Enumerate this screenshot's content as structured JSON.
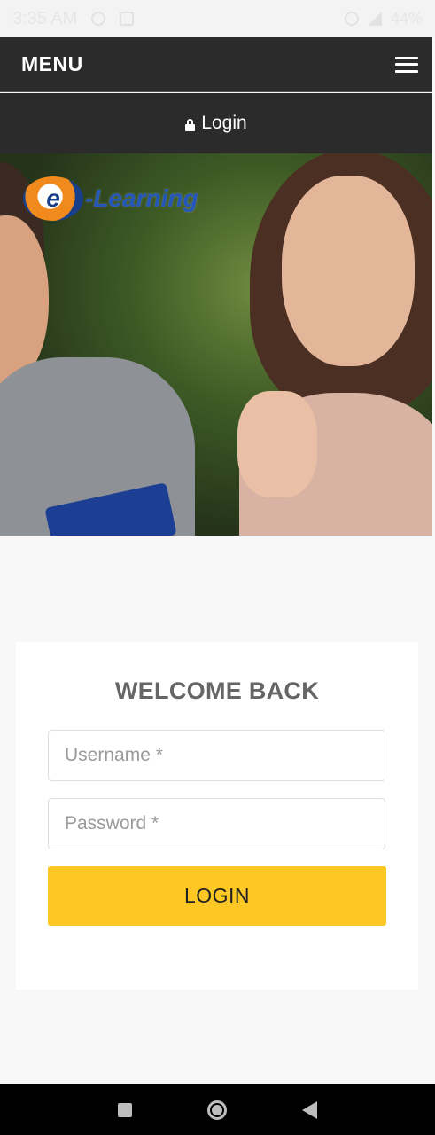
{
  "status_bar": {
    "time": "3:35 AM",
    "battery": "44%"
  },
  "menu": {
    "title": "MENU",
    "hamburger_icon": "hamburger-menu-icon"
  },
  "login_link": {
    "label": "Login",
    "icon": "lock-icon"
  },
  "hero": {
    "logo_letter": "e",
    "logo_text": "-Learning"
  },
  "form": {
    "title": "WELCOME BACK",
    "username_placeholder": "Username *",
    "password_placeholder": "Password *",
    "submit_label": "LOGIN"
  },
  "colors": {
    "header_bg": "#2b2b2b",
    "button_bg": "#fdc823",
    "page_bg": "#f8f8f8"
  },
  "nav": {
    "recents_icon": "square-icon",
    "home_icon": "home-circle-icon",
    "back_icon": "back-triangle-icon"
  }
}
